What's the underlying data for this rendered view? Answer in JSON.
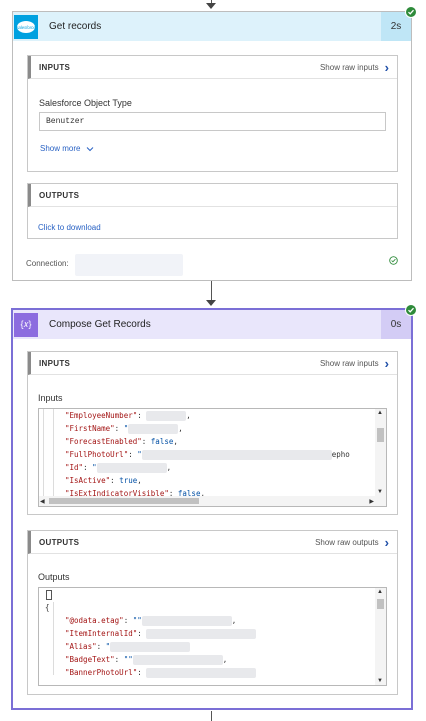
{
  "card1": {
    "title": "Get records",
    "duration": "2s",
    "app": "salesforce",
    "colors": {
      "header_bg": "#ddf2fb",
      "duration_bg": "#bfe6f6",
      "icon_bg": "#00a1e0"
    },
    "inputs": {
      "label": "INPUTS",
      "raw_link": "Show raw inputs",
      "field_label": "Salesforce Object Type",
      "field_value": "Benutzer",
      "show_more": "Show more"
    },
    "outputs": {
      "label": "OUTPUTS",
      "download_link": "Click to download"
    },
    "connection_label": "Connection:"
  },
  "card2": {
    "title": "Compose Get Records",
    "duration": "0s",
    "icon_text": "{𝑥}",
    "colors": {
      "header_bg": "#e9e6fb",
      "duration_bg": "#d3ccf5",
      "icon_bg": "#8c6cdf"
    },
    "inputs": {
      "label": "INPUTS",
      "raw_link": "Show raw inputs",
      "section_label": "Inputs",
      "lines": [
        {
          "key": "\"EmployeeNumber\"",
          "sep": ": ",
          "value": "",
          "tail": ","
        },
        {
          "key": "\"FirstName\"",
          "sep": ": ",
          "value": "\"",
          "tail": ","
        },
        {
          "key": "\"ForecastEnabled\"",
          "sep": ": ",
          "value": "false",
          "tail": ","
        },
        {
          "key": "\"FullPhotoUrl\"",
          "sep": ": ",
          "value": "\"",
          "tail": "epho"
        },
        {
          "key": "\"Id\"",
          "sep": ": ",
          "value": "\"",
          "tail": ","
        },
        {
          "key": "\"IsActive\"",
          "sep": ": ",
          "value": "true",
          "tail": ","
        },
        {
          "key": "\"IsExtIndicatorVisible\"",
          "sep": ": ",
          "value": "false",
          "tail": ","
        }
      ]
    },
    "outputs": {
      "label": "OUTPUTS",
      "raw_link": "Show raw outputs",
      "section_label": "Outputs",
      "open_brace": "{",
      "lines": [
        {
          "key": "\"@odata.etag\"",
          "sep": ": ",
          "value": "\"\"",
          "tail": ","
        },
        {
          "key": "\"ItemInternalId\"",
          "sep": ": ",
          "value": "",
          "tail": ""
        },
        {
          "key": "\"Alias\"",
          "sep": ": ",
          "value": "\"",
          "tail": ""
        },
        {
          "key": "\"BadgeText\"",
          "sep": ": ",
          "value": "\"\"",
          "tail": ","
        },
        {
          "key": "\"BannerPhotoUrl\"",
          "sep": ": ",
          "value": "",
          "tail": ""
        }
      ]
    }
  }
}
